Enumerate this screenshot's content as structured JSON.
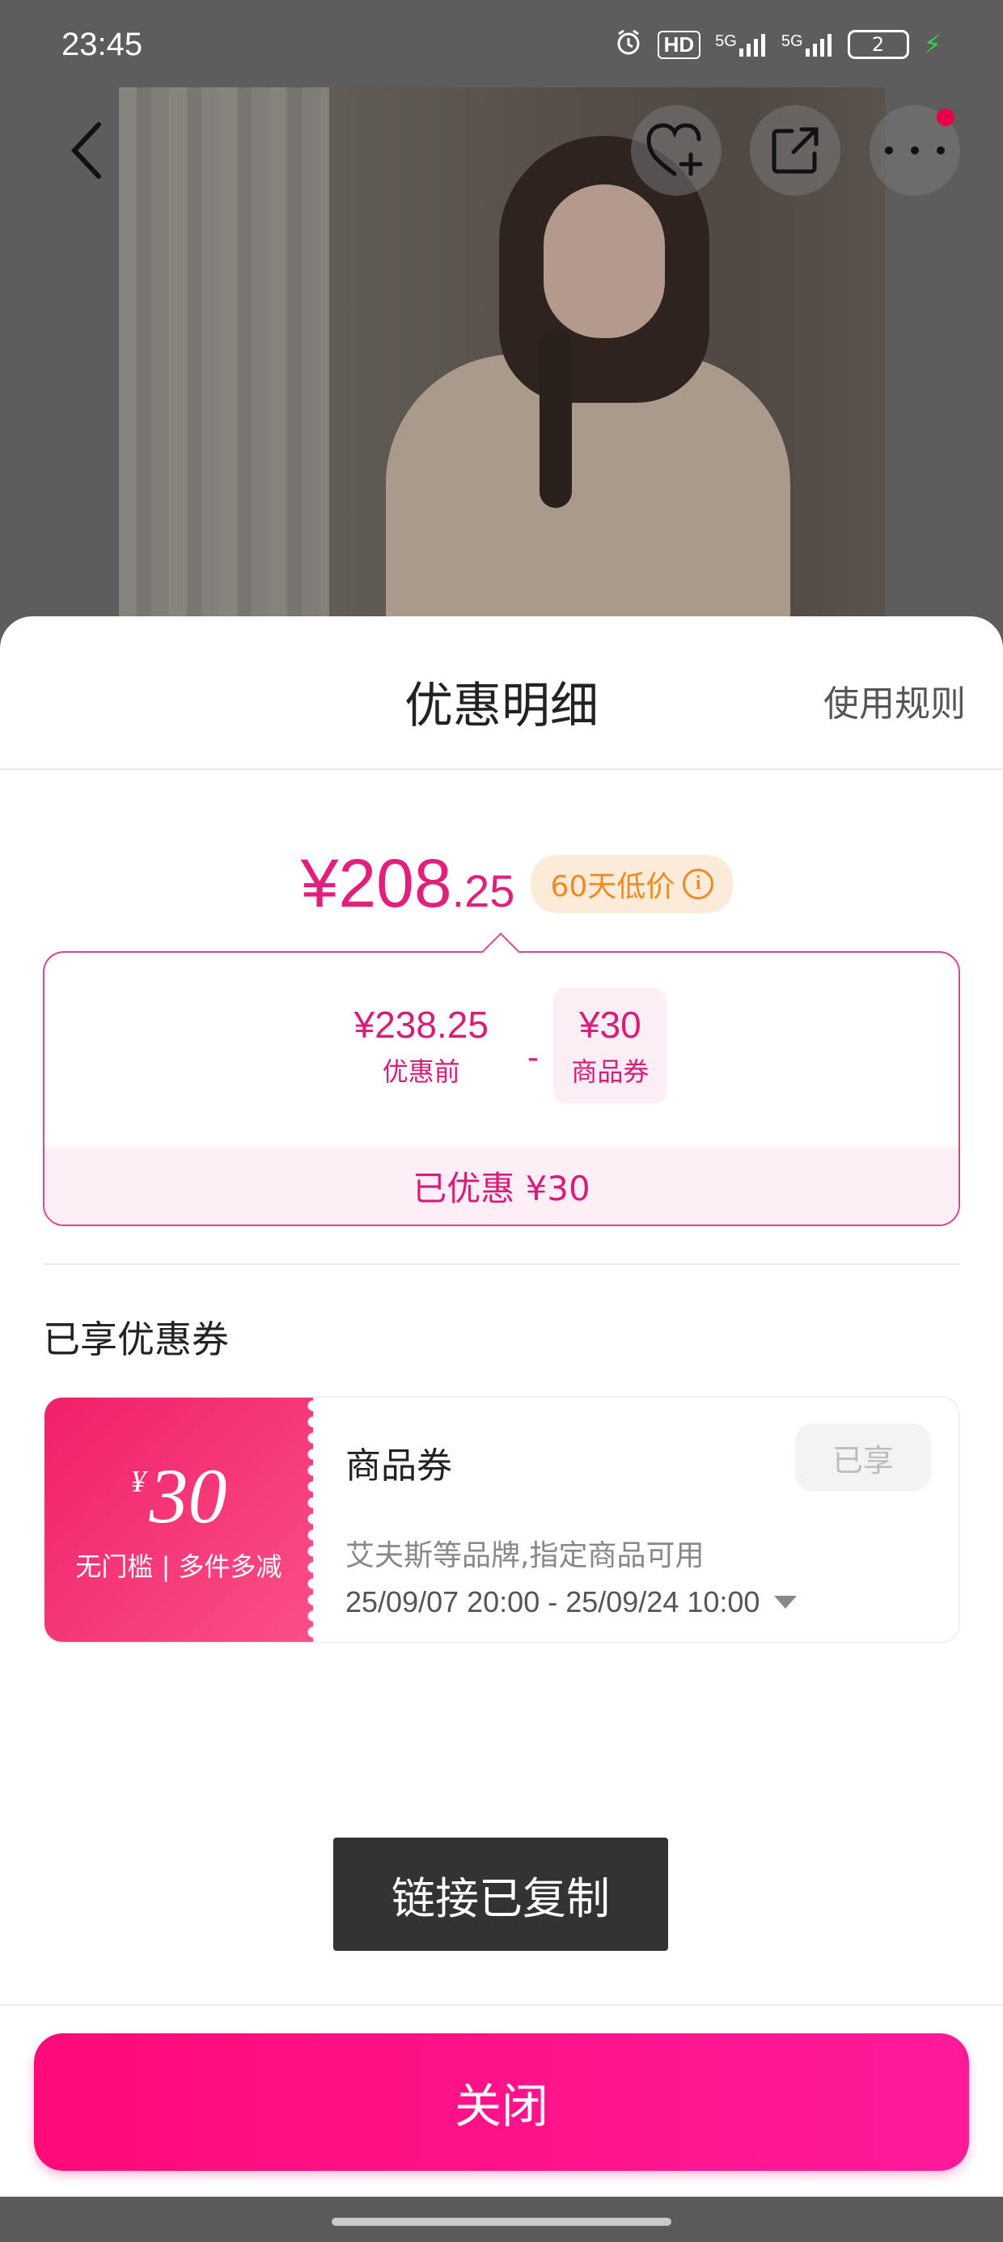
{
  "status_bar": {
    "time": "23:45",
    "hd_label": "HD",
    "net1_label": "5G",
    "net2_label": "5G",
    "battery_level": "2"
  },
  "sheet": {
    "title": "优惠明细",
    "rules_link": "使用规则",
    "final_price_main": "¥208",
    "final_price_decimal": ".25",
    "low_price_badge": "60天低价",
    "breakdown": {
      "original_amount": "¥238.25",
      "original_label": "优惠前",
      "minus": "-",
      "coupon_amount": "¥30",
      "coupon_label": "商品券",
      "saved_text": "已优惠 ¥30"
    },
    "enjoyed_section_title": "已享优惠券",
    "coupon": {
      "currency": "¥",
      "value": "30",
      "condition": "无门槛 | 多件多减",
      "name": "商品券",
      "status": "已享",
      "description": "艾夫斯等品牌,指定商品可用",
      "validity": "25/09/07 20:00 - 25/09/24 10:00"
    },
    "toast": "链接已复制",
    "close_button": "关闭"
  },
  "colors": {
    "accent": "#e21f7a",
    "button": "#ff0b79",
    "badge_text": "#f0891f"
  }
}
